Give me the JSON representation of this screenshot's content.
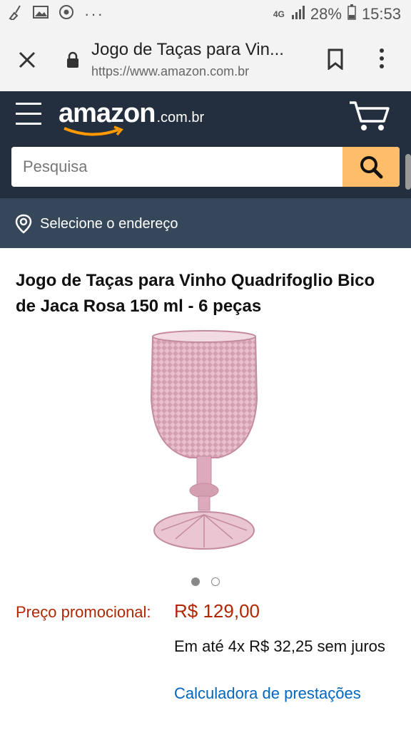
{
  "status_bar": {
    "network": "4G",
    "battery_percent": "28%",
    "time": "15:53"
  },
  "browser": {
    "tab_title": "Jogo de Taças para Vin...",
    "url": "https://www.amazon.com.br"
  },
  "amazon_header": {
    "logo_word": "amazon",
    "logo_tld": ".com.br",
    "search_placeholder": "Pesquisa",
    "address_prompt": "Selecione o endereço"
  },
  "product": {
    "title": "Jogo de Taças para Vinho Quadrifoglio Bico de Jaca Rosa 150 ml - 6 peças",
    "image_count": 2,
    "active_image_index": 0,
    "price_label": "Preço promocional:",
    "price_value": "R$ 129,00",
    "installments_text": "Em até 4x R$ 32,25 sem juros",
    "calculator_link": "Calculadora de prestações"
  },
  "colors": {
    "header_bg": "#232f3e",
    "address_bg": "#37475a",
    "search_button": "#febd69",
    "price": "#b12704",
    "link": "#0066c0"
  }
}
